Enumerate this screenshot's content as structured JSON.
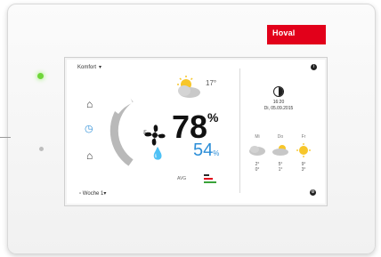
{
  "brand": {
    "logo": "Hoval",
    "color": "#e2001a"
  },
  "screen": {
    "mode_label": "Komfort",
    "mode_chevron": "▾",
    "info_label": "i",
    "outdoor_temp": "17°",
    "humidity_value": "78",
    "humidity_unit": "%",
    "humidity_target": "54",
    "humidity_target_unit": "%",
    "avg_label": "AVG",
    "week_program": "Woche 1",
    "week_chevron": "▾",
    "side_icons": [
      "home-icon",
      "clock-icon",
      "home-away-icon"
    ],
    "accent_blue": "#2c8ed8"
  },
  "sidebar": {
    "time": "16:20",
    "date": "Di, 05.09.2015",
    "forecast": [
      {
        "day": "Mi",
        "high": "2°",
        "low": "0°",
        "icon": "cloud-icon"
      },
      {
        "day": "Do",
        "high": "5°",
        "low": "1°",
        "icon": "cloud-sun-icon"
      },
      {
        "day": "Fr",
        "high": "9°",
        "low": "3°",
        "icon": "sun-icon"
      }
    ],
    "settings_label": "⚙"
  }
}
